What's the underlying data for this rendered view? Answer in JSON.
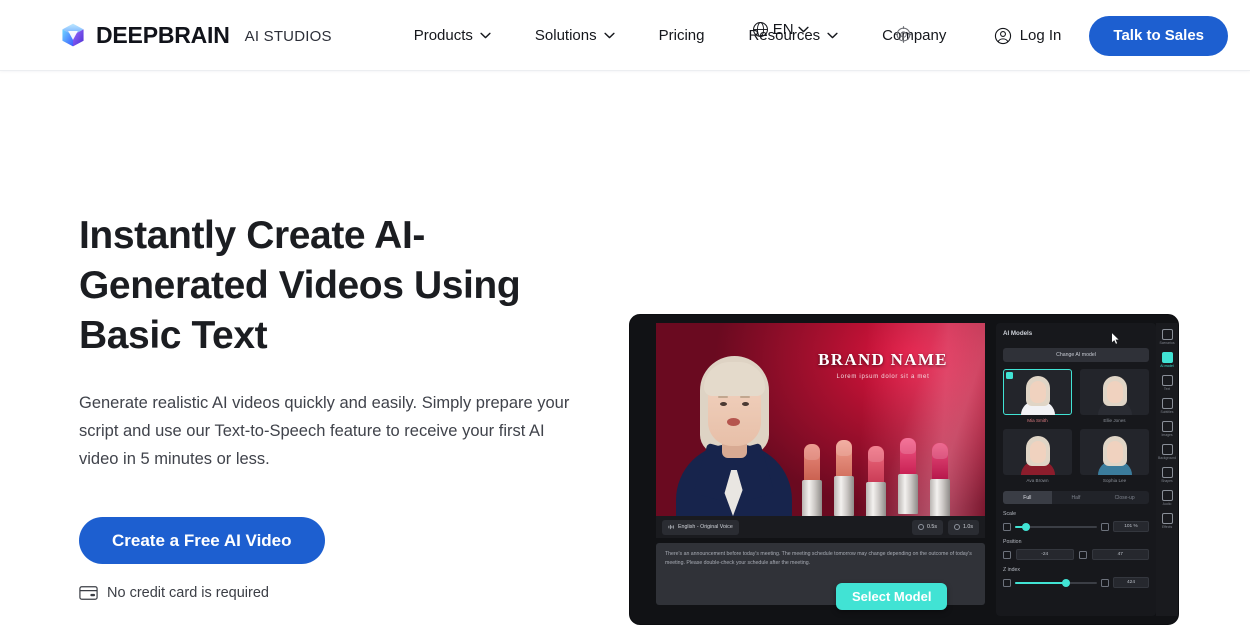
{
  "header": {
    "brand": {
      "word": "DEEPBRAIN",
      "sub": "AI STUDIOS",
      "logo_icon": "cube-logo-icon"
    },
    "nav": [
      {
        "label": "Products",
        "has_dropdown": true
      },
      {
        "label": "Solutions",
        "has_dropdown": true
      },
      {
        "label": "Pricing",
        "has_dropdown": false
      },
      {
        "label": "Resources",
        "has_dropdown": true
      },
      {
        "label": "Company",
        "has_dropdown": true
      }
    ],
    "language": {
      "label": "EN",
      "icon": "globe-icon"
    },
    "login": {
      "label": "Log In",
      "icon": "user-circle-icon"
    },
    "cta": {
      "label": "Talk to Sales"
    }
  },
  "hero": {
    "title": "Instantly Create AI-Generated Videos Using Basic Text",
    "subtitle": "Generate realistic AI videos quickly and easily. Simply prepare your script and use our Text-to-Speech feature to receive your first AI video in 5 minutes or less.",
    "cta_label": "Create a Free AI Video",
    "note": "No credit card is required",
    "note_icon": "credit-card-icon"
  },
  "mockup": {
    "stage": {
      "brand_name": "BRAND NAME",
      "brand_tagline": "Lorem ipsum dolor sit a met"
    },
    "toolbar": {
      "language_pill": "English - Original Voice",
      "language_icon": "sound-wave-icon",
      "chips": [
        {
          "label": "0.5s",
          "icon": "clock-icon"
        },
        {
          "label": "1.0s",
          "icon": "clock-icon"
        }
      ]
    },
    "script": "There's an announcement before today's meeting. The meeting schedule tomorrow may change depending on the outcome of today's meeting. Please double-check your schedule after the meeting.",
    "select_model_label": "Select Model",
    "panel": {
      "title": "AI Models",
      "change_button": "Change AI model",
      "models": [
        {
          "name": "Mia Smith",
          "selected": true,
          "shirt": "#f2f2f5"
        },
        {
          "name": "Ellie Jones",
          "selected": false,
          "shirt": "#2a2c33"
        },
        {
          "name": "Ava Brown",
          "selected": false,
          "shirt": "#8c1d2c"
        },
        {
          "name": "Sophia Lee",
          "selected": false,
          "shirt": "#3b7c9c"
        }
      ],
      "segments": [
        {
          "label": "Full",
          "active": true
        },
        {
          "label": "Half",
          "active": false
        },
        {
          "label": "Close-up",
          "active": false
        }
      ],
      "controls": [
        {
          "label": "Scale",
          "type": "slider",
          "value": "101 %",
          "fill_pct": 14
        },
        {
          "label": "Position",
          "type": "pair",
          "x": "-24",
          "y": "47"
        },
        {
          "label": "Z index",
          "type": "slider",
          "value": "424",
          "fill_pct": 62
        }
      ]
    },
    "rail": [
      {
        "label": "Scenarios",
        "icon": "scenario-icon",
        "active": false
      },
      {
        "label": "AI model",
        "icon": "avatar-icon",
        "active": true
      },
      {
        "label": "Text",
        "icon": "text-icon",
        "active": false
      },
      {
        "label": "Subtitles",
        "icon": "subtitle-icon",
        "active": false
      },
      {
        "label": "Images",
        "icon": "image-icon",
        "active": false
      },
      {
        "label": "Background",
        "icon": "background-icon",
        "active": false
      },
      {
        "label": "Shapes",
        "icon": "shapes-icon",
        "active": false
      },
      {
        "label": "Audio",
        "icon": "audio-icon",
        "active": false
      },
      {
        "label": "Effects",
        "icon": "effects-icon",
        "active": false
      }
    ]
  },
  "colors": {
    "brand_blue": "#1d5fd0",
    "accent_teal": "#41e3d4",
    "text_dark": "#1b1d21",
    "mock_bg": "#111215"
  }
}
